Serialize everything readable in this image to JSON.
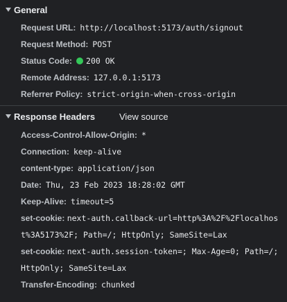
{
  "general": {
    "title": "General",
    "rows": [
      {
        "key": "Request URL:",
        "value": "http://localhost:5173/auth/signout"
      },
      {
        "key": "Request Method:",
        "value": "POST"
      },
      {
        "key": "Status Code:",
        "value": "200 OK",
        "status_color": "#34c759"
      },
      {
        "key": "Remote Address:",
        "value": "127.0.0.1:5173"
      },
      {
        "key": "Referrer Policy:",
        "value": "strict-origin-when-cross-origin"
      }
    ]
  },
  "response_headers": {
    "title": "Response Headers",
    "view_source": "View source",
    "rows": [
      {
        "key": "Access-Control-Allow-Origin:",
        "value": "*"
      },
      {
        "key": "Connection:",
        "value": "keep-alive"
      },
      {
        "key": "content-type:",
        "value": "application/json"
      },
      {
        "key": "Date:",
        "value": "Thu, 23 Feb 2023 18:28:02 GMT"
      },
      {
        "key": "Keep-Alive:",
        "value": "timeout=5"
      },
      {
        "key": "set-cookie:",
        "value": "next-auth.callback-url=http%3A%2F%2Flocalhost%3A5173%2F; Path=/; HttpOnly; SameSite=Lax"
      },
      {
        "key": "set-cookie:",
        "value": "next-auth.session-token=; Max-Age=0; Path=/; HttpOnly; SameSite=Lax"
      },
      {
        "key": "Transfer-Encoding:",
        "value": "chunked"
      }
    ]
  }
}
